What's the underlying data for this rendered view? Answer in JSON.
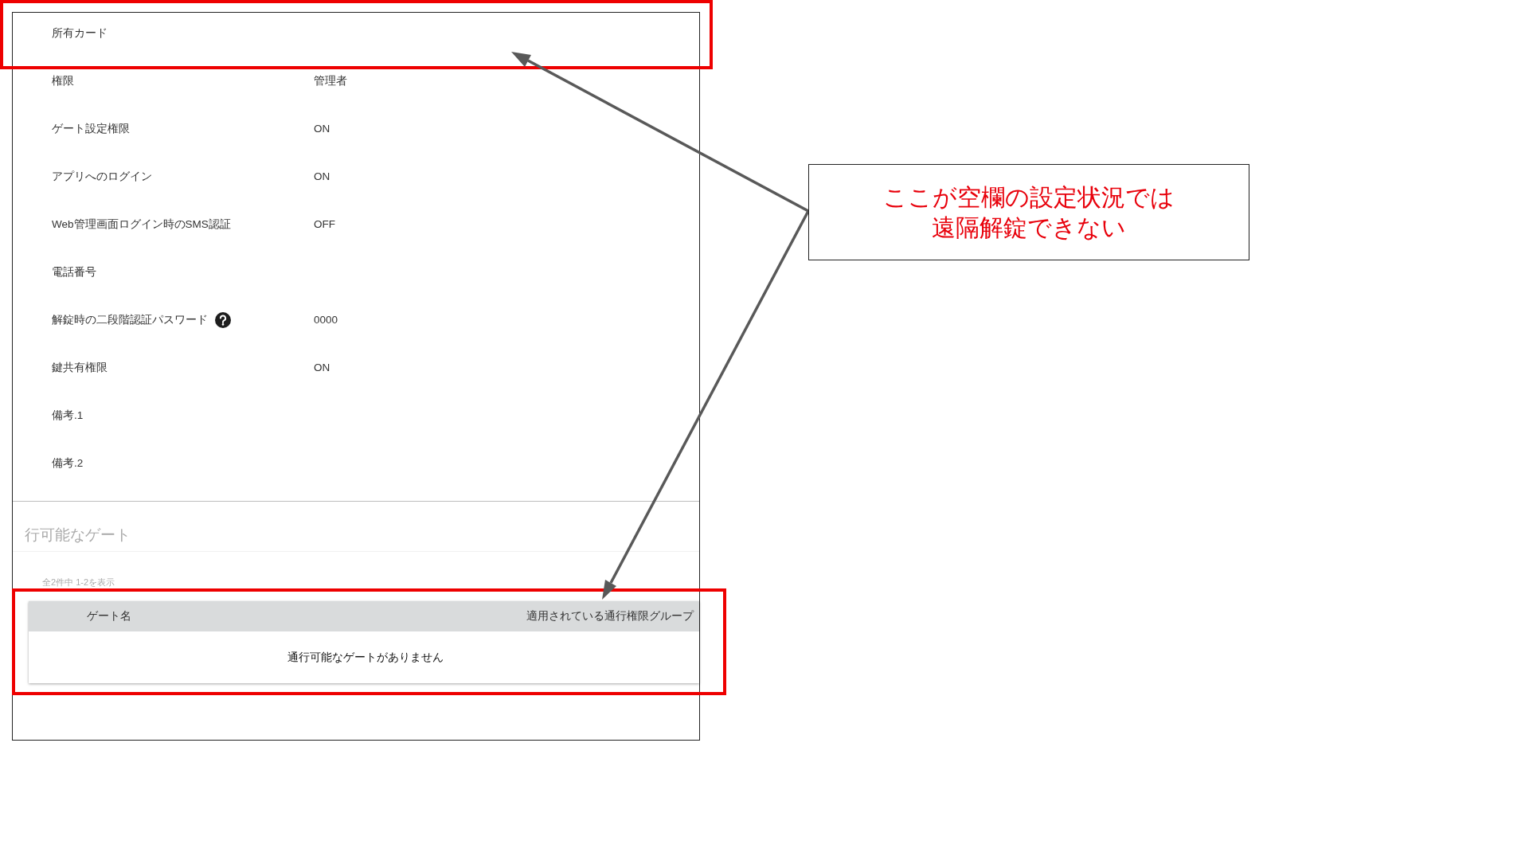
{
  "details": {
    "rows": [
      {
        "label": "所有カード",
        "help": false
      },
      {
        "label": "権限",
        "value": "管理者",
        "help": false
      },
      {
        "label": "ゲート設定権限",
        "value": "ON",
        "help": false
      },
      {
        "label": "アプリへのログイン",
        "value": "ON",
        "help": false
      },
      {
        "label": "Web管理画面ログイン時のSMS認証",
        "value": "OFF",
        "help": false
      },
      {
        "label": "電話番号",
        "help": false
      },
      {
        "label": "解錠時の二段階認証パスワード",
        "value": "0000",
        "help": true
      },
      {
        "label": "鍵共有権限",
        "value": "ON",
        "help": false
      },
      {
        "label": "備考.1",
        "help": false
      },
      {
        "label": "備考.2",
        "help": false
      }
    ]
  },
  "gates_section": {
    "heading": "行可能なゲート",
    "count_text": "全2件中 1-2を表示",
    "table": {
      "columns": [
        "ゲート名",
        "適用されている通行権限グループ"
      ],
      "empty_message": "通行可能なゲートがありません"
    }
  },
  "annotation": {
    "callout_lines": [
      "ここが空欄の設定状況では",
      "遠隔解錠できない"
    ]
  }
}
